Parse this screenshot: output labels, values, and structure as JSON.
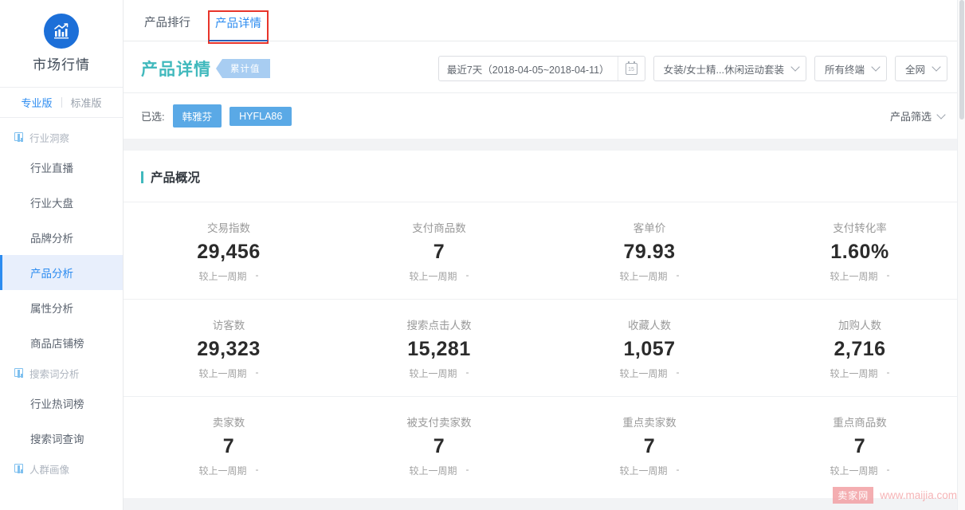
{
  "sidebar": {
    "brand": {
      "name": "市场行情",
      "logo_icon": "chart-bars-icon",
      "logo_color": "#1c6fd8"
    },
    "versions": [
      {
        "label": "专业版",
        "active": true
      },
      {
        "label": "标准版",
        "active": false
      }
    ],
    "nav": [
      {
        "type": "group",
        "label": "行业洞察",
        "icon": "chart-group-icon"
      },
      {
        "type": "item",
        "label": "行业直播",
        "active": false
      },
      {
        "type": "item",
        "label": "行业大盘",
        "active": false
      },
      {
        "type": "item",
        "label": "品牌分析",
        "active": false
      },
      {
        "type": "item",
        "label": "产品分析",
        "active": true
      },
      {
        "type": "item",
        "label": "属性分析",
        "active": false
      },
      {
        "type": "item",
        "label": "商品店铺榜",
        "active": false
      },
      {
        "type": "group",
        "label": "搜索词分析",
        "icon": "chart-group-icon"
      },
      {
        "type": "item",
        "label": "行业热词榜",
        "active": false
      },
      {
        "type": "item",
        "label": "搜索词查询",
        "active": false
      },
      {
        "type": "group",
        "label": "人群画像",
        "icon": "chart-group-icon"
      }
    ]
  },
  "tabs": [
    {
      "label": "产品排行",
      "active": false,
      "highlighted": false
    },
    {
      "label": "产品详情",
      "active": true,
      "highlighted": true
    }
  ],
  "header": {
    "title": "产品详情",
    "badge": "累计值",
    "date_range": "最近7天（2018-04-05~2018-04-11）",
    "calendar_icon": "calendar-icon",
    "calendar_day": "15",
    "category_select": "女装/女士精...休闲运动套装",
    "terminal_select": "所有终端",
    "network_select": "全网"
  },
  "selected": {
    "label": "已选:",
    "tags": [
      "韩雅芬",
      "HYFLA86"
    ],
    "product_filter": "产品筛选",
    "filter_chevron_icon": "chevron-down-icon"
  },
  "overview": {
    "section_title": "产品概况",
    "accent_color": "#41b9bd",
    "compare_label": "较上一周期",
    "compare_value": "-",
    "rows": [
      [
        {
          "label": "交易指数",
          "value": "29,456"
        },
        {
          "label": "支付商品数",
          "value": "7"
        },
        {
          "label": "客单价",
          "value": "79.93"
        },
        {
          "label": "支付转化率",
          "value": "1.60%"
        }
      ],
      [
        {
          "label": "访客数",
          "value": "29,323"
        },
        {
          "label": "搜索点击人数",
          "value": "15,281"
        },
        {
          "label": "收藏人数",
          "value": "1,057"
        },
        {
          "label": "加购人数",
          "value": "2,716"
        }
      ],
      [
        {
          "label": "卖家数",
          "value": "7"
        },
        {
          "label": "被支付卖家数",
          "value": "7"
        },
        {
          "label": "重点卖家数",
          "value": "7"
        },
        {
          "label": "重点商品数",
          "value": "7"
        }
      ]
    ]
  },
  "watermark": {
    "badge": "卖家网",
    "url": "www.maijia.com"
  }
}
